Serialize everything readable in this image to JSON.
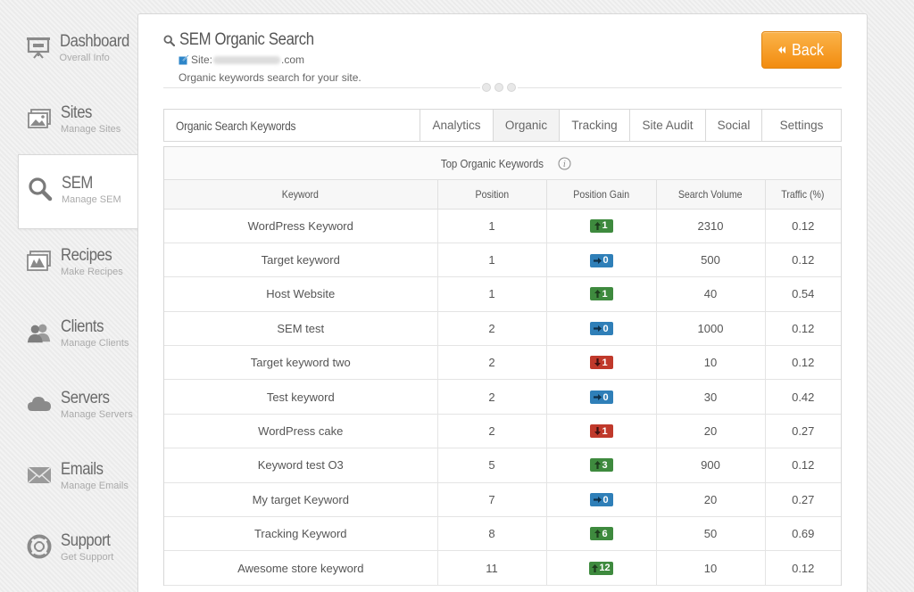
{
  "sidebar": {
    "items": [
      {
        "title": "Dashboard",
        "sub": "Overall Info",
        "icon": "presentation-board-icon",
        "active": false
      },
      {
        "title": "Sites",
        "sub": "Manage Sites",
        "icon": "image-gallery-icon",
        "active": false
      },
      {
        "title": "SEM",
        "sub": "Manage SEM",
        "icon": "magnifier-icon",
        "active": true
      },
      {
        "title": "Recipes",
        "sub": "Make Recipes",
        "icon": "recipe-image-icon",
        "active": false
      },
      {
        "title": "Clients",
        "sub": "Manage Clients",
        "icon": "users-icon",
        "active": false
      },
      {
        "title": "Servers",
        "sub": "Manage Servers",
        "icon": "cloud-icon",
        "active": false
      },
      {
        "title": "Emails",
        "sub": "Manage Emails",
        "icon": "envelope-icon",
        "active": false
      },
      {
        "title": "Support",
        "sub": "Get Support",
        "icon": "lifebuoy-icon",
        "active": false
      }
    ]
  },
  "header": {
    "title": "SEM Organic Search",
    "site_prefix": "Site:",
    "site_suffix": ".com",
    "description": "Organic keywords search for your site.",
    "back_label": "Back"
  },
  "tabbar": {
    "title": "Organic Search Keywords",
    "tabs": [
      "Analytics",
      "Organic",
      "Tracking",
      "Site Audit",
      "Social",
      "Settings"
    ],
    "active": "Organic"
  },
  "table": {
    "caption": "Top Organic Keywords",
    "columns": [
      "Keyword",
      "Position",
      "Position Gain",
      "Search Volume",
      "Traffic (%)"
    ],
    "rows": [
      {
        "keyword": "WordPress Keyword",
        "position": "1",
        "gain": "1",
        "dir": "up",
        "volume": "2310",
        "traffic": "0.12"
      },
      {
        "keyword": "Target keyword",
        "position": "1",
        "gain": "0",
        "dir": "flat",
        "volume": "500",
        "traffic": "0.12"
      },
      {
        "keyword": "Host Website",
        "position": "1",
        "gain": "1",
        "dir": "up",
        "volume": "40",
        "traffic": "0.54"
      },
      {
        "keyword": "SEM test",
        "position": "2",
        "gain": "0",
        "dir": "flat",
        "volume": "1000",
        "traffic": "0.12"
      },
      {
        "keyword": "Target keyword two",
        "position": "2",
        "gain": "1",
        "dir": "down",
        "volume": "10",
        "traffic": "0.12"
      },
      {
        "keyword": "Test keyword",
        "position": "2",
        "gain": "0",
        "dir": "flat",
        "volume": "30",
        "traffic": "0.42"
      },
      {
        "keyword": "WordPress cake",
        "position": "2",
        "gain": "1",
        "dir": "down",
        "volume": "20",
        "traffic": "0.27"
      },
      {
        "keyword": "Keyword test O3",
        "position": "5",
        "gain": "3",
        "dir": "up",
        "volume": "900",
        "traffic": "0.12"
      },
      {
        "keyword": "My target Keyword",
        "position": "7",
        "gain": "0",
        "dir": "flat",
        "volume": "20",
        "traffic": "0.27"
      },
      {
        "keyword": "Tracking Keyword",
        "position": "8",
        "gain": "6",
        "dir": "up",
        "volume": "50",
        "traffic": "0.69"
      },
      {
        "keyword": "Awesome store keyword",
        "position": "11",
        "gain": "12",
        "dir": "up",
        "volume": "10",
        "traffic": "0.12"
      }
    ]
  },
  "colors": {
    "accent": "#f39a1d",
    "gain_up": "#3e8a3e",
    "gain_flat": "#2f7fb8",
    "gain_down": "#c0392b"
  }
}
